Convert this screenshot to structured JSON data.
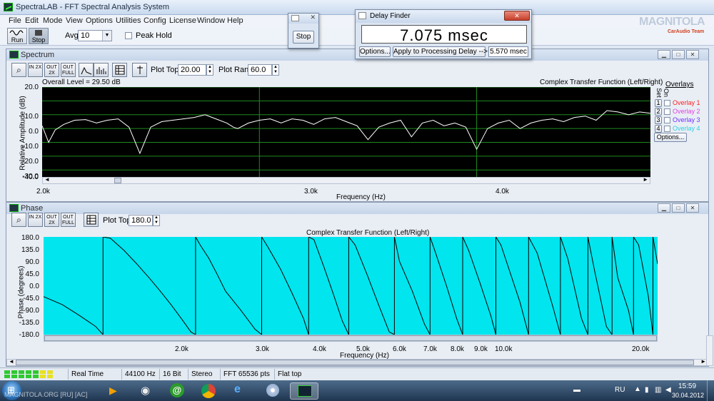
{
  "app": {
    "title": "SpectraLAB - FFT Spectral Analysis System",
    "menu": [
      "File",
      "Edit",
      "Mode",
      "View",
      "Options",
      "Utilities",
      "Config",
      "License",
      "Window",
      "Help"
    ],
    "toolbar": {
      "run_label": "Run",
      "stop_label": "Stop",
      "avg_label": "Avg:",
      "avg_value": "10",
      "peak_hold_label": "Peak Hold"
    }
  },
  "spectrum": {
    "window_title": "Spectrum",
    "zoom_labels": [
      "IN 2X",
      "OUT 2X",
      "OUT FULL"
    ],
    "plot_top_label": "Plot Top:",
    "plot_top_value": "20.00",
    "plot_range_label": "Plot Range:",
    "plot_range_value": "60.0",
    "overall_level": "Overall Level = 29.50 dB",
    "plot_title": "Complex Transfer Function (Left/Right)",
    "ylabel": "Relative Amplitude (dB)",
    "xlabel": "Frequency (Hz)",
    "y_ticks": [
      "20.0",
      "10.0",
      "0.0",
      "-10.0",
      "-20.0",
      "-30.0",
      "-40.0"
    ],
    "x_ticks": [
      "2.0k",
      "3.0k",
      "4.0k"
    ],
    "overlays": {
      "title": "Overlays",
      "col_set": "Set",
      "col_on": "On",
      "items": [
        {
          "num": "1",
          "label": "Overlay 1",
          "color": "#ff2020"
        },
        {
          "num": "2",
          "label": "Overlay 2",
          "color": "#e040e0"
        },
        {
          "num": "3",
          "label": "Overlay 3",
          "color": "#7030ff"
        },
        {
          "num": "4",
          "label": "Overlay 4",
          "color": "#30d0e0"
        }
      ],
      "options_label": "Options..."
    },
    "colors": {
      "background": "#000000",
      "grid": "#1f8a1f",
      "trace": "#ffffff"
    }
  },
  "phase": {
    "window_title": "Phase",
    "plot_top_label": "Plot Top:",
    "plot_top_value": "180.0",
    "plot_title": "Complex Transfer Function (Left/Right)",
    "ylabel": "Phase (degrees)",
    "xlabel": "Frequency (Hz)",
    "y_ticks": [
      "180.0",
      "135.0",
      "90.0",
      "45.0",
      "0.0",
      "-45.0",
      "-90.0",
      "-135.0",
      "-180.0"
    ],
    "x_ticks": [
      "2.0k",
      "3.0k",
      "4.0k",
      "5.0k",
      "6.0k",
      "7.0k",
      "8.0k",
      "9.0k",
      "10.0k",
      "20.0k"
    ],
    "colors": {
      "background": "#00e5ee",
      "trace": "#000000"
    }
  },
  "stop_dialog": {
    "stop_label": "Stop"
  },
  "delay_finder": {
    "title": "Delay Finder",
    "delay_value": "7.075 msec",
    "options_label": "Options...",
    "apply_label": "Apply to Processing Delay -->",
    "processing_delay": "5.570 msec"
  },
  "statusbar": {
    "mode": "Real Time",
    "sample_rate": "44100 Hz",
    "bits": "16 Bit",
    "channels": "Stereo",
    "fft_size": "FFT 65536 pts",
    "window": "Flat top"
  },
  "watermark": {
    "main": "MAGNITOLA",
    "sub": "CarAudio Team"
  },
  "taskbar": {
    "lang": "RU",
    "time": "15:59",
    "date": "30.04.2012",
    "overlay_text": "MAGNITOLA.ORG [RU] [AC]"
  },
  "chart_data": [
    {
      "type": "line",
      "title": "Complex Transfer Function (Left/Right)",
      "xlabel": "Frequency (Hz)",
      "ylabel": "Relative Amplitude (dB)",
      "ylim": [
        -45,
        20
      ],
      "xlim": [
        2000,
        4800
      ],
      "grid": true,
      "series": [
        {
          "x": [
            2000,
            2030,
            2060,
            2100,
            2150,
            2200,
            2250,
            2300,
            2350,
            2400,
            2450,
            2500,
            2550,
            2600,
            2650,
            2700,
            2750,
            2800,
            2850,
            2880,
            2900,
            2950,
            3000,
            3050,
            3100,
            3150,
            3200,
            3250,
            3300,
            3350,
            3400,
            3450,
            3500,
            3550,
            3600,
            3650,
            3700,
            3750,
            3800,
            3850,
            3900,
            3950,
            4000,
            4050,
            4100,
            4150,
            4200,
            4250,
            4300,
            4350,
            4400,
            4450,
            4500,
            4550,
            4600,
            4650,
            4700,
            4750,
            4800
          ],
          "y": [
            -8,
            -20,
            -11,
            -7,
            -4,
            -3.5,
            -6,
            -4,
            -3,
            -9,
            -28,
            -9,
            -5,
            -4,
            -3,
            -2,
            0,
            -3,
            -6,
            -9,
            -10,
            -6,
            -4,
            -3,
            -6,
            -3,
            -4,
            -7,
            -3,
            -2,
            -5,
            -8,
            -18,
            -9,
            -6,
            -4,
            -16,
            -6,
            -4,
            -8,
            -6,
            -9,
            -25,
            -10,
            -6,
            -4,
            -10,
            -6,
            -4,
            -3,
            -5,
            -2,
            -1,
            -4,
            3,
            2,
            0,
            2,
            1
          ]
        }
      ]
    },
    {
      "type": "line",
      "title": "Complex Transfer Function (Left/Right)",
      "xlabel": "Frequency (Hz)",
      "ylabel": "Phase (degrees)",
      "ylim": [
        -180,
        180
      ],
      "xlim": [
        1000,
        22000
      ],
      "x_scale": "log",
      "series": [
        {
          "x": [
            1000,
            1100,
            1200,
            1300,
            1400,
            1500,
            1600,
            1700,
            1800,
            1900,
            2000,
            2100,
            2200,
            2300,
            2400,
            2500,
            2700,
            2900,
            3100,
            3300,
            3500,
            3700,
            3900,
            4100,
            4300,
            4500,
            4800,
            5100,
            5400,
            5700,
            6000,
            6400,
            6800,
            7200,
            7600,
            8000,
            8500,
            9000,
            9500,
            10000,
            11000,
            12000,
            13000,
            14000,
            15000,
            16000,
            17000,
            18000,
            19000,
            20000,
            21000,
            22000
          ],
          "y": [
            -40,
            -70,
            -110,
            -150,
            175,
            130,
            80,
            30,
            -20,
            -70,
            -120,
            -170,
            150,
            100,
            40,
            -20,
            -90,
            -160,
            140,
            60,
            -30,
            -120,
            170,
            70,
            -30,
            -130,
            150,
            40,
            -70,
            -170,
            90,
            -20,
            -140,
            120,
            0,
            -120,
            130,
            10,
            -110,
            150,
            -60,
            120,
            -80,
            100,
            -120,
            60,
            -150,
            30,
            -90,
            150,
            -40,
            80
          ]
        }
      ]
    }
  ]
}
